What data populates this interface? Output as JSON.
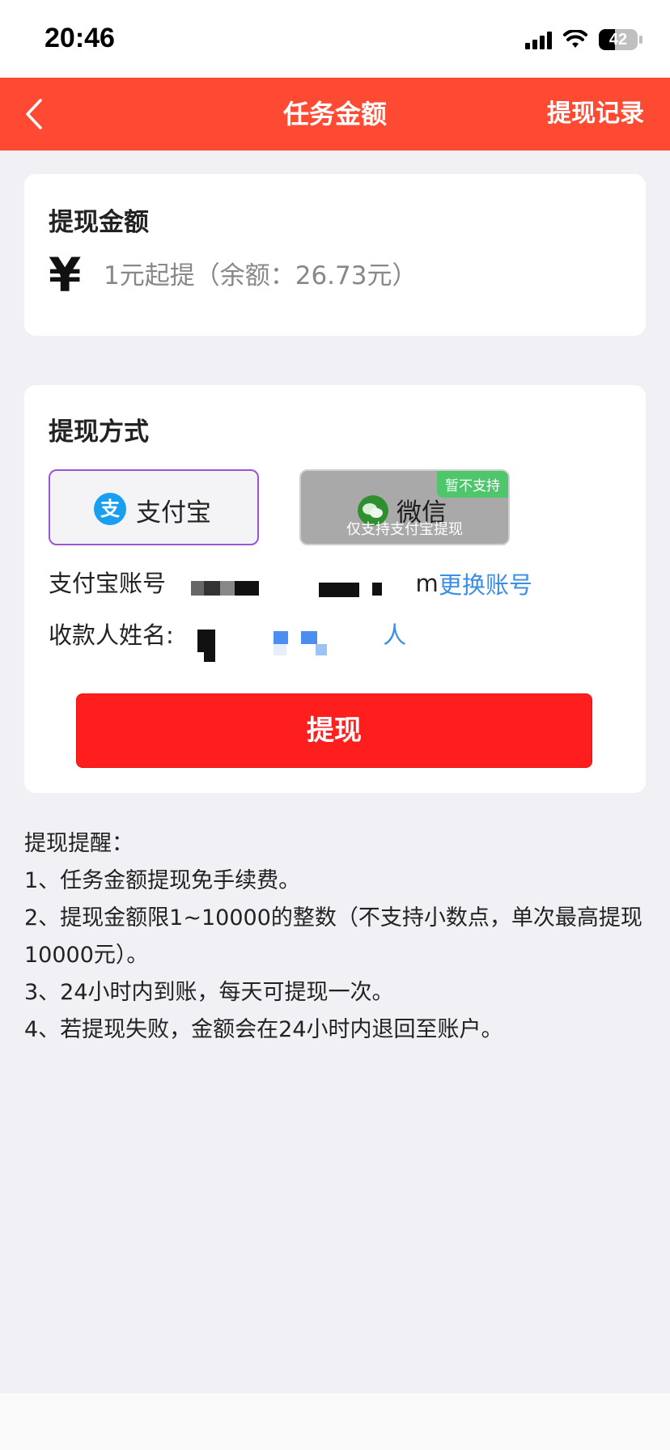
{
  "status_bar": {
    "time": "20:46",
    "battery": "42"
  },
  "nav": {
    "title": "任务金额",
    "record_link": "提现记录"
  },
  "amount_card": {
    "title": "提现金额",
    "currency": "¥",
    "placeholder": "1元起提（余额：26.73元）"
  },
  "method_card": {
    "title": "提现方式",
    "methods": [
      {
        "label": "支付宝",
        "icon": "alipay-icon",
        "selected": true
      },
      {
        "label": "微信",
        "icon": "wechat-icon",
        "badge": "暂不支持",
        "sub": "仅支持支付宝提现"
      }
    ],
    "account_label": "支付宝账号",
    "account_value_visible": "m",
    "change_account": "更换账号",
    "payee_label": "收款人姓名",
    "payee_value_visible": "人",
    "withdraw_button": "提现"
  },
  "tips": {
    "title": "提现提醒：",
    "items": [
      "1、任务金额提现免手续费。",
      "2、提现金额限1~10000的整数（不支持小数点，单次最高提现10000元）。",
      "3、24小时内到账，每天可提现一次。",
      "4、若提现失败，金额会在24小时内退回至账户。"
    ]
  },
  "colors": {
    "nav_bg": "#ff4a33",
    "button_bg": "#ff1e1e",
    "link": "#3a8ee6",
    "alipay": "#1a9ff0",
    "wechat_badge": "#4ec66c"
  }
}
